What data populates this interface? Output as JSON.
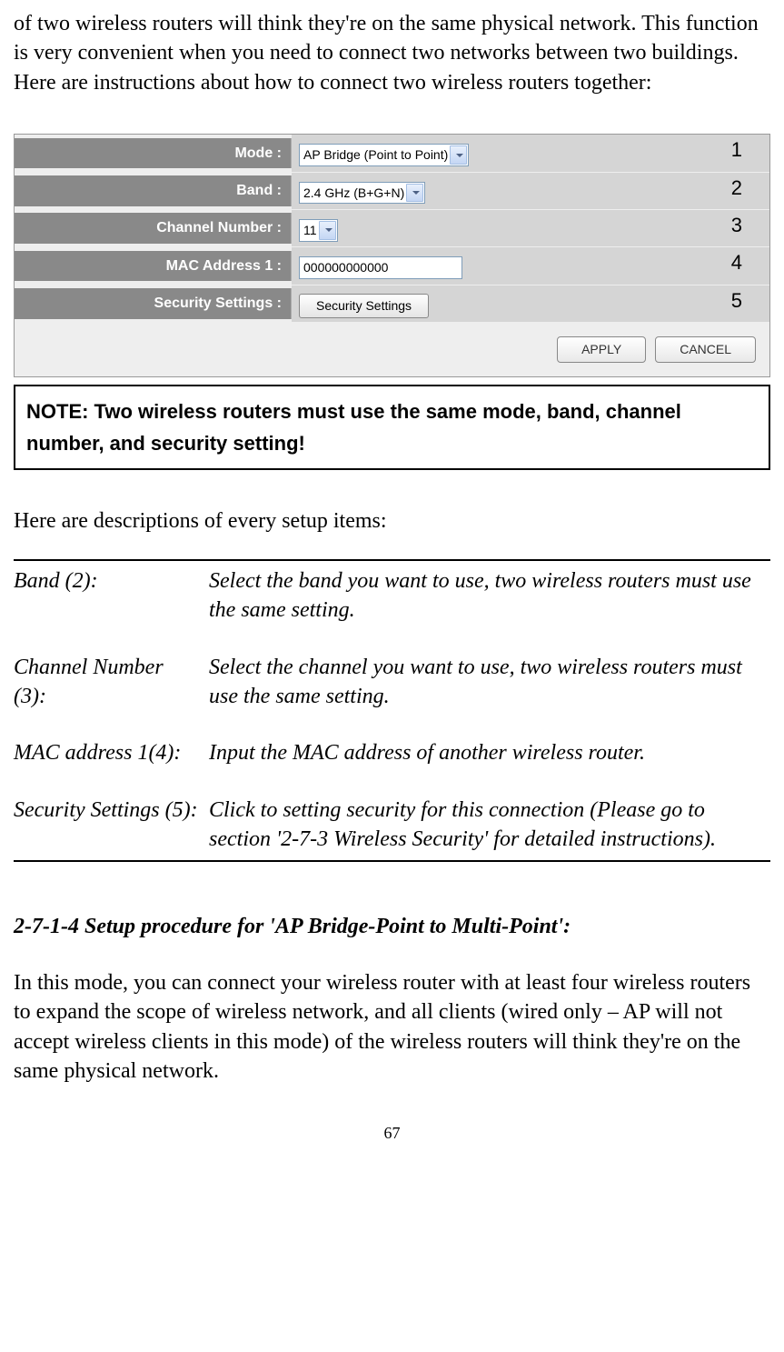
{
  "intro": "of two wireless routers will think they're on the same physical network. This function is very convenient when you need to connect two networks between two buildings. Here are instructions about how to connect two wireless routers together:",
  "config": {
    "rows": [
      {
        "label": "Mode :",
        "type": "select",
        "value": "AP Bridge (Point to Point)",
        "num": "1"
      },
      {
        "label": "Band :",
        "type": "select",
        "value": "2.4 GHz (B+G+N)",
        "num": "2"
      },
      {
        "label": "Channel Number :",
        "type": "select",
        "value": "11",
        "num": "3"
      },
      {
        "label": "MAC Address 1 :",
        "type": "input",
        "value": "000000000000",
        "num": "4"
      },
      {
        "label": "Security Settings :",
        "type": "button",
        "value": "Security Settings",
        "num": "5"
      }
    ],
    "apply": "APPLY",
    "cancel": "CANCEL"
  },
  "note": "NOTE: Two wireless routers must use the same mode, band, channel number, and security setting!",
  "desc_intro": "Here are descriptions of every setup items:",
  "descriptions": [
    {
      "term": "Band (2):",
      "def": "Select the band you want to use, two wireless routers must use the same setting."
    },
    {
      "term": "Channel Number (3):",
      "def": "Select the channel you want to use, two wireless routers must use the same setting."
    },
    {
      "term": "MAC address 1(4):",
      "def": "Input the MAC address of another wireless router."
    },
    {
      "term": "Security Settings (5):",
      "def": "Click to setting security for this connection (Please go to section '2-7-3 Wireless Security' for detailed instructions)."
    }
  ],
  "section": {
    "heading": "2-7-1-4 Setup procedure for 'AP Bridge-Point to Multi-Point':",
    "body": "In this mode, you can connect your wireless router with at least four wireless routers to expand the scope of wireless network, and all clients (wired only – AP will not accept wireless clients in this mode) of the wireless routers will think they're on the same physical network."
  },
  "page_number": "67"
}
